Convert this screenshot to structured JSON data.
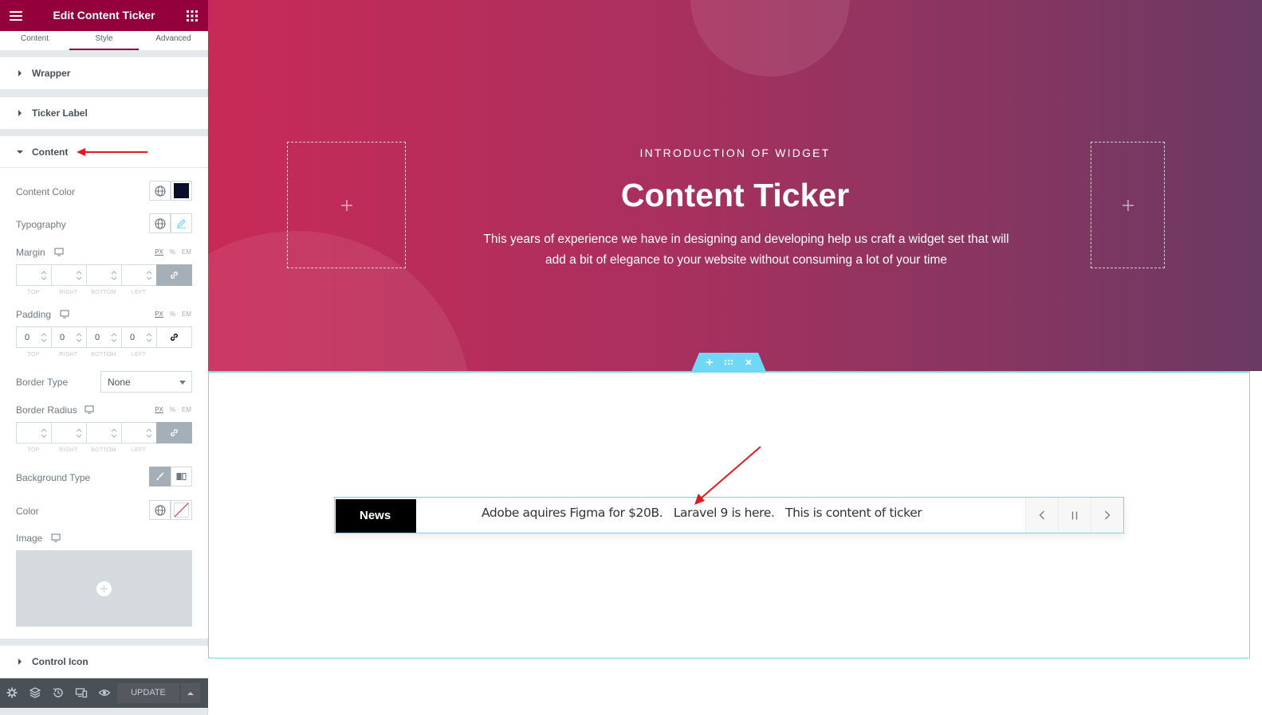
{
  "panel": {
    "title": "Edit Content Ticker",
    "tabs": [
      {
        "label": "Content",
        "active": false
      },
      {
        "label": "Style",
        "active": true
      },
      {
        "label": "Advanced",
        "active": false
      }
    ],
    "sections": {
      "wrapper": "Wrapper",
      "ticker_label": "Ticker Label",
      "content": "Content",
      "control_icon": "Control Icon"
    },
    "controls": {
      "content_color": {
        "label": "Content Color",
        "swatch": "#0a0e2a"
      },
      "typography": {
        "label": "Typography"
      },
      "margin": {
        "label": "Margin",
        "units": [
          "PX",
          "%",
          "EM"
        ],
        "values": [
          "",
          "",
          "",
          ""
        ]
      },
      "padding": {
        "label": "Padding",
        "units": [
          "PX",
          "%",
          "EM"
        ],
        "values": [
          "0",
          "0",
          "0",
          "0"
        ]
      },
      "dim_labels": [
        "TOP",
        "RIGHT",
        "BOTTOM",
        "LEFT"
      ],
      "border_type": {
        "label": "Border Type",
        "value": "None"
      },
      "border_radius": {
        "label": "Border Radius",
        "units": [
          "PX",
          "%",
          "EM"
        ]
      },
      "background_type": {
        "label": "Background Type"
      },
      "color": {
        "label": "Color"
      },
      "image": {
        "label": "Image"
      }
    },
    "footer": {
      "update_label": "UPDATE"
    }
  },
  "canvas": {
    "hero": {
      "eyebrow": "INTRODUCTION OF WIDGET",
      "title": "Content Ticker",
      "description": "This years of experience we have in designing and developing help us craft a widget set that will add a bit of elegance to your website without consuming a lot of your time"
    },
    "ticker": {
      "label": "News",
      "items": [
        "Adobe aquires Figma for $20B.",
        "Laravel 9 is here.",
        "This is content of ticker"
      ]
    }
  },
  "colors": {
    "brand": "#93003c",
    "accent": "#71d7f7",
    "annotation_arrow": "#e3191f"
  },
  "icons": [
    "menu-icon",
    "apps-grid-icon",
    "globe-icon",
    "pencil-icon",
    "desktop-icon",
    "link-icon",
    "brush-icon",
    "gradient-icon",
    "plus-icon",
    "settings-icon",
    "layers-icon",
    "history-icon",
    "responsive-icon",
    "eye-icon",
    "chevron-left-icon",
    "pause-icon",
    "chevron-right-icon",
    "drag-icon",
    "close-icon"
  ]
}
